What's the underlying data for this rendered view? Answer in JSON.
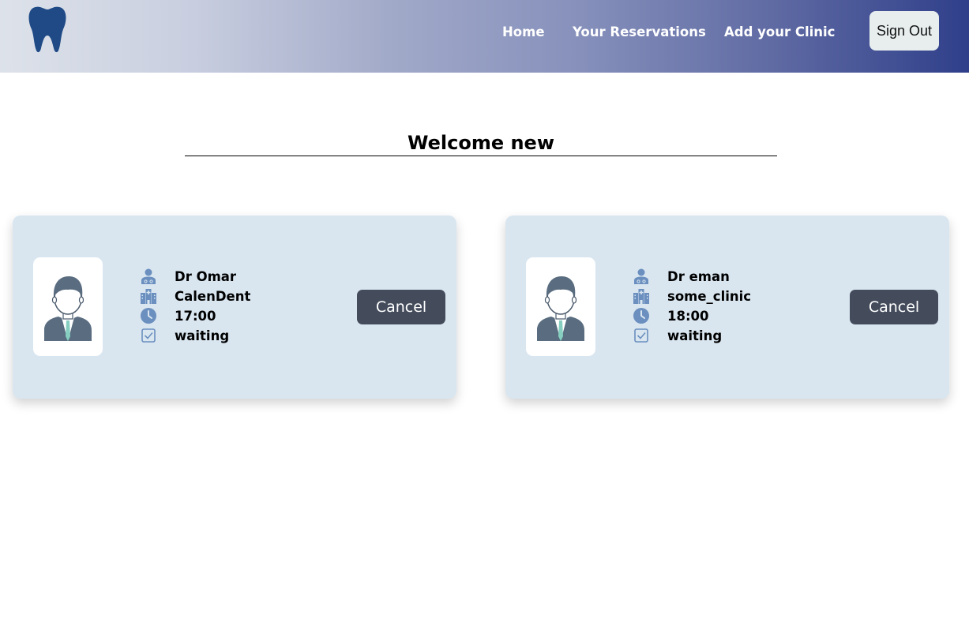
{
  "nav": {
    "logo_icon": "tooth-icon",
    "links": [
      "Home",
      "Your Reservations",
      "Add your Clinic"
    ],
    "signout_label": "Sign Out"
  },
  "welcome": "Welcome new",
  "reservations": [
    {
      "avatar_icon": "doctor-avatar-icon",
      "doctor": "Dr Omar",
      "clinic": "CalenDent",
      "time": "17:00",
      "status": "waiting",
      "cancel_label": "Cancel"
    },
    {
      "avatar_icon": "doctor-avatar-icon",
      "doctor": "Dr eman",
      "clinic": "some_clinic",
      "time": "18:00",
      "status": "waiting",
      "cancel_label": "Cancel"
    }
  ],
  "colors": {
    "header_gradient_start": "#dde2ea",
    "header_gradient_end": "#2f3f8a",
    "card_background": "#d9e6f0",
    "cancel_button": "#444c5c",
    "icon_blue": "#6b8fbf",
    "tooth_blue": "#1f4a86"
  }
}
